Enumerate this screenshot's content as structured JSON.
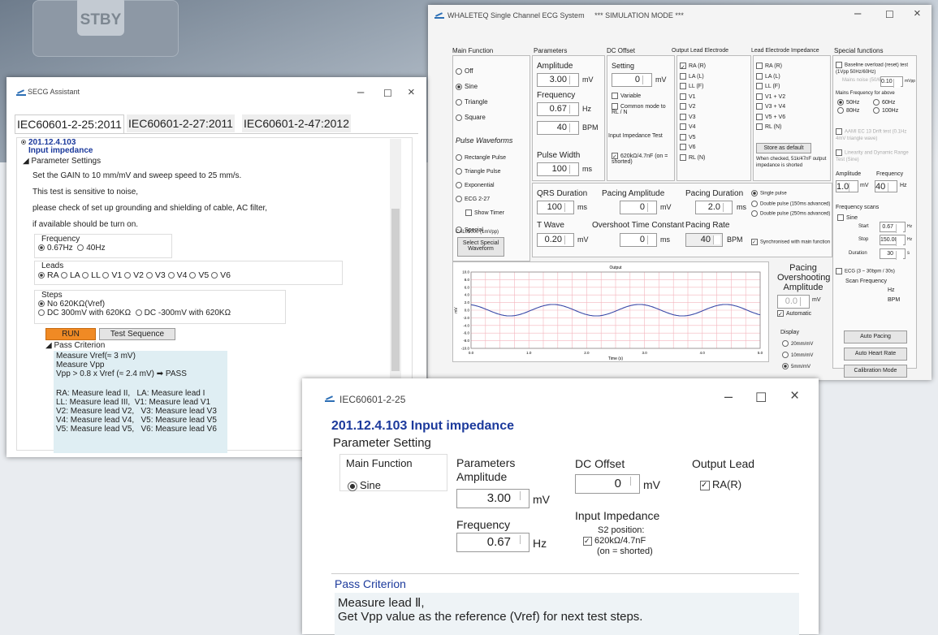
{
  "background": {
    "key_label": "STBY"
  },
  "w1": {
    "title": "SECG Assistant",
    "tabs": [
      "IEC60601-2-25:2011",
      "IEC60601-2-27:2011",
      "IEC60601-2-47:2012"
    ],
    "clause": "201.12.4.103",
    "clause_title": "Input impedance",
    "param_heading": "Parameter Settings",
    "lines": [
      "Set the GAIN to 10 mm/mV and sweep speed to 25 mm/s.",
      "This test is sensitive to noise,",
      "please check of set up grounding and shielding of cable, AC filter,",
      "if available should be turn on."
    ],
    "frequency_label": "Frequency",
    "freq_options": [
      "0.67Hz",
      "40Hz"
    ],
    "leads_label": "Leads",
    "lead_options": [
      "RA",
      "LA",
      "LL",
      "V1",
      "V2",
      "V3",
      "V4",
      "V5",
      "V6"
    ],
    "steps_label": "Steps",
    "step_options": [
      "No 620KΩ(Vref)",
      "DC 300mV with 620KΩ",
      "DC -300mV with 620KΩ"
    ],
    "run": "RUN",
    "test_sequence": "Test Sequence",
    "pass_heading": "Pass Criterion",
    "criteria": [
      "Measure Vref(≈ 3 mV)",
      "Measure Vpp",
      "Vpp > 0.8 x Vref (≈ 2.4 mV) ➡ PASS"
    ],
    "leads_map": [
      "RA: Measure lead II,   LA: Measure lead I",
      "LL: Measure lead III,  V1: Measure lead V1",
      "V2: Measure lead V2,   V3: Measure lead V3",
      "V4: Measure lead V4,   V5: Measure lead V5",
      "V5: Measure lead V5,   V6: Measure lead V6"
    ]
  },
  "w2": {
    "title": "WHALETEQ Single Channel ECG System",
    "mode": "*** SIMULATION MODE ***",
    "heads": [
      "Main Function",
      "Parameters",
      "DC Offset",
      "Output Lead Electrode",
      "Lead Electrode Impedance",
      "Special functions"
    ],
    "main": [
      "Off",
      "Sine",
      "Triangle",
      "Square"
    ],
    "pulse_head": "Pulse Waveforms",
    "pulse": [
      "Rectangle Pulse",
      "Triangle Pulse",
      "Exponential",
      "ECG 2-27",
      "Special"
    ],
    "show_timer": "Show Timer",
    "cal": "CAL05000 (1mVpp)",
    "select_special": "Select Special Waveform",
    "amplitude": "Amplitude",
    "amp_val": "3.00",
    "mv": "mV",
    "frequency": "Frequency",
    "freq_val": "0.67",
    "hz": "Hz",
    "bpm_val": "40",
    "bpm": "BPM",
    "pulse_width": "Pulse Width",
    "pw_val": "100",
    "ms": "ms",
    "setting": "Setting",
    "dc_val": "0",
    "variable": "Variable",
    "common_mode": "Common mode to RL / N",
    "input_imp_test": "Input Impedance Test",
    "imp_620": "620kΩ/4.7nF (on = shorted)",
    "out_leads": [
      "RA (R)",
      "LA (L)",
      "LL (F)",
      "V1",
      "V2",
      "V3",
      "V4",
      "V5",
      "V6",
      "RL (N)"
    ],
    "imp_leads": [
      "RA (R)",
      "LA (L)",
      "LL (F)",
      "V1 + V2",
      "V3 + V4",
      "V5 + V6",
      "RL (N)"
    ],
    "store": "Store as default",
    "store_note": "When checked, 51k/47nF output impedance is shorted",
    "sp_baseline": "Baseline overload (reset) test (1Vpp 50Hz/60Hz)",
    "sp_mains": "Mains noise (50/60Hz)",
    "sp_mains_val": "0.10",
    "sp_mvpp": "mVpp",
    "mains_freq": "Mains Frequency for above",
    "mf": [
      "50Hz",
      "60Hz",
      "80Hz",
      "100Hz"
    ],
    "aami": "AAMI EC 13 Drift test (0.1Hz 4mV triangle wave)",
    "linearity": "Linearity and Dynamic Range Test (Sine)",
    "lin_amp": "Amplitude",
    "lin_freq": "Frequency",
    "lin_amp_val": "1.0",
    "lin_freq_val": "40",
    "qrs": "QRS Duration",
    "qrs_val": "100",
    "pace_amp": "Pacing Amplitude",
    "pace_amp_val": "0",
    "pace_dur": "Pacing Duration",
    "pace_dur_val": "2.0",
    "single": "Single pulse",
    "double150": "Double pulse (150ms advanced)",
    "double250": "Double pulse (250ms advanced)",
    "twave": "T Wave",
    "twave_val": "0.20",
    "overshoot": "Overshoot Time Constant",
    "overshoot_val": "0",
    "pace_rate": "Pacing Rate",
    "pace_rate_val": "40",
    "sync": "Synchronised with main function",
    "fscan": "Frequency scans",
    "fs_sine": "Sine",
    "start": "Start",
    "start_val": "0.67",
    "stop": "Stop",
    "stop_val": "150.00",
    "duration": "Duration",
    "dur_val": "30",
    "s": "s",
    "ecg_scan": "ECG (3 ~ 30bpm / 30s)",
    "scan_freq": "Scan Frequency",
    "scan_hz": "Hz",
    "scan_bpm": "BPM",
    "output": "Output",
    "time": "Time (s)",
    "xticks": [
      "0.0",
      "1.0",
      "2.0",
      "3.0",
      "4.0",
      "5.0"
    ],
    "yticks": [
      "10.0",
      "8.0",
      "6.0",
      "4.0",
      "2.0",
      "0.0",
      "-2.0",
      "-4.0",
      "-6.0",
      "-8.0",
      "-10.0"
    ],
    "povr": "Pacing Overshooting Amplitude",
    "povr_val": "0.0",
    "automatic": "Automatic",
    "display": "Display",
    "disp": [
      "20mm/mV",
      "10mm/mV",
      "5mm/mV"
    ],
    "auto_pacing": "Auto Pacing",
    "auto_hr": "Auto Heart Rate",
    "calib": "Calibration Mode"
  },
  "w3": {
    "title": "IEC60601-2-25",
    "clause": "201.12.4.103 Input impedance",
    "param": "Parameter Setting",
    "main": "Main Function",
    "sine": "Sine",
    "params": "Parameters",
    "amplitude": "Amplitude",
    "amp_val": "3.00",
    "mv": "mV",
    "frequency": "Frequency",
    "freq_val": "0.67",
    "hz": "Hz",
    "dc": "DC Offset",
    "dc_val": "0",
    "out_lead": "Output Lead",
    "ra": "RA(R)",
    "input_imp": "Input Impedance",
    "s2": "S2 position:",
    "imp": "620kΩ/4.7nF",
    "shorted": "(on = shorted)",
    "pass": "Pass Criterion",
    "m1": "Measure lead  Ⅱ,",
    "m2": "Get Vpp value as the reference (Vref) for next test steps."
  },
  "chart_data": {
    "type": "line",
    "title": "Output",
    "xlabel": "Time (s)",
    "ylabel": "mV",
    "xlim": [
      0,
      5
    ],
    "ylim": [
      -10,
      10
    ],
    "series": [
      {
        "values": "sine",
        "amplitude_mV": 1.5,
        "frequency_Hz": 0.67
      }
    ],
    "grid": true
  }
}
